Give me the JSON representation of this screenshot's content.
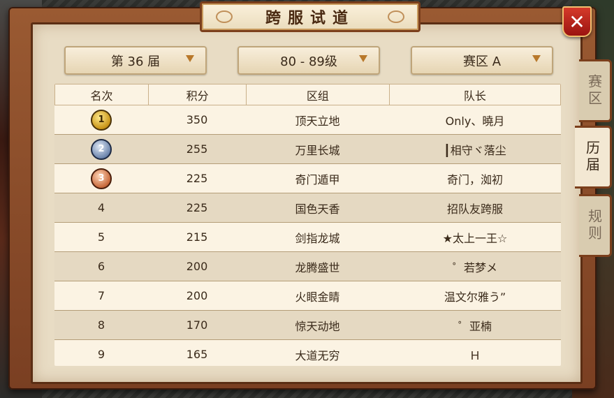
{
  "window": {
    "title": "跨服试道"
  },
  "filters": {
    "season": "第 36 届",
    "level": "80 - 89级",
    "zone": "赛区 A"
  },
  "table": {
    "headers": [
      "名次",
      "积分",
      "区组",
      "队长"
    ],
    "rows": [
      {
        "rank": "1",
        "score": "350",
        "group": "顶天立地",
        "captain": "Only、曉月"
      },
      {
        "rank": "2",
        "score": "255",
        "group": "万里长城",
        "captain": "┃相守ヾ落尘"
      },
      {
        "rank": "3",
        "score": "225",
        "group": "奇门遁甲",
        "captain": "奇门，洳初"
      },
      {
        "rank": "4",
        "score": "225",
        "group": "国色天香",
        "captain": "招队友跨服"
      },
      {
        "rank": "5",
        "score": "215",
        "group": "剑指龙城",
        "captain": "★太上一王☆"
      },
      {
        "rank": "6",
        "score": "200",
        "group": "龙腾盛世",
        "captain": "゜若梦メ"
      },
      {
        "rank": "7",
        "score": "200",
        "group": "火眼金睛",
        "captain": "温文尔雅う”"
      },
      {
        "rank": "8",
        "score": "170",
        "group": "惊天动地",
        "captain": "゜亚楠"
      },
      {
        "rank": "9",
        "score": "165",
        "group": "大道无穷",
        "captain": "Ｈ"
      }
    ]
  },
  "side_tabs": {
    "zone": "赛区",
    "history": "历届",
    "rules": "规则"
  },
  "icons": {
    "close": "close-icon",
    "dropdown": "triangle-down-icon",
    "medals": [
      "gold-medal-icon",
      "silver-medal-icon",
      "bronze-medal-icon"
    ]
  },
  "colors": {
    "frame": "#7a3f22",
    "panel": "#e8dcc4",
    "close": "#c0261a",
    "dropdown_arrow": "#b8782a"
  }
}
